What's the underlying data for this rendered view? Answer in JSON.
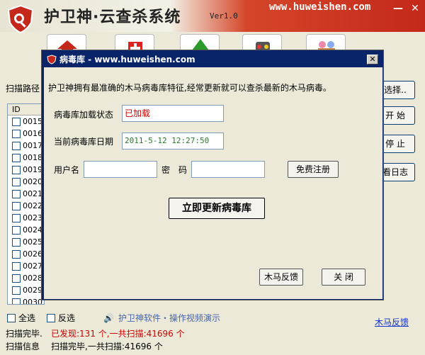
{
  "app": {
    "title": "护卫神·云查杀系统",
    "version": "Ver1.0",
    "url": "www.huweishen.com"
  },
  "window": {
    "minimize": "—",
    "close": "✕"
  },
  "main": {
    "scan_path_label": "扫描路径",
    "list_header": "ID",
    "rows": [
      "0015",
      "0016",
      "0017",
      "0018",
      "0019",
      "0020",
      "0021",
      "0022",
      "0023",
      "0024",
      "0025",
      "0026",
      "0027",
      "0028",
      "0029",
      "0030"
    ],
    "buttons": [
      "选择..",
      "开 始",
      "停 止",
      "看日志"
    ],
    "select_all": "全选",
    "invert": "反选",
    "software_link": "护卫神软件・操作视频演示",
    "trojan_feedback": "木马反馈",
    "status1_label": "扫描完毕.",
    "status1_value": "已发现:131 个,一共扫描:41696 个",
    "status2_label": "扫描信息",
    "status2_value": "扫描完毕,一共扫描:41696 个"
  },
  "dialog": {
    "title": "病毒库 - www.huweishen.com",
    "close": "✕",
    "desc": "护卫神拥有最准确的木马病毒库特征,经常更新就可以查杀最新的木马病毒。",
    "load_label": "病毒库加载状态",
    "load_value": "已加载",
    "date_label": "当前病毒库日期",
    "date_value": "2011-5-12 12:27:50",
    "user_label": "用户名",
    "pass_label": "密　码",
    "user_value": "",
    "pass_value": "",
    "register": "免费注册",
    "update": "立即更新病毒库",
    "feedback": "木马反馈",
    "close_btn": "关 闭"
  },
  "colors": {
    "accent": "#c4281a",
    "dialog_title": "#0a246a",
    "status_red": "#cc0000",
    "date_green": "#2a7a2a"
  }
}
